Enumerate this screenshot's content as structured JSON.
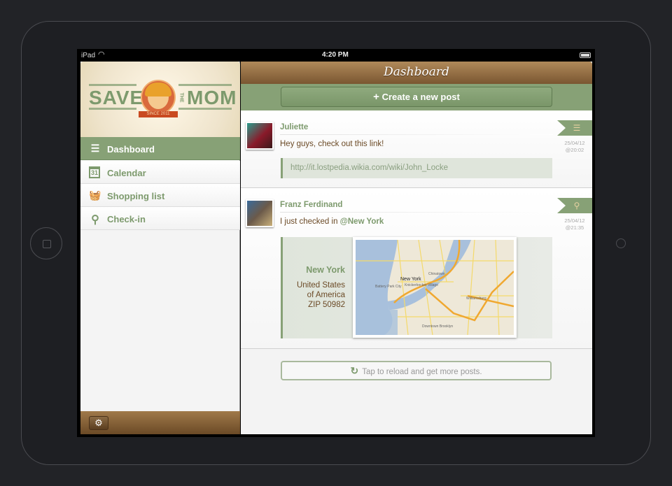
{
  "status_bar": {
    "device": "iPad",
    "time": "4:20 PM"
  },
  "logo": {
    "left": "SAVE",
    "small": "THE",
    "right": "MOM",
    "ribbon": "SINCE 2011"
  },
  "sidebar": {
    "items": [
      {
        "label": "Dashboard",
        "icon": "list-icon",
        "selected": true
      },
      {
        "label": "Calendar",
        "icon": "calendar-icon",
        "icon_text": "31"
      },
      {
        "label": "Shopping list",
        "icon": "basket-icon"
      },
      {
        "label": "Check-in",
        "icon": "map-pin-icon"
      }
    ],
    "settings_icon": "gear-icon"
  },
  "header": {
    "title": "Dashboard"
  },
  "toolbar": {
    "create_label": "Create a new post",
    "create_icon": "+"
  },
  "posts": [
    {
      "author": "Juliette",
      "text": "Hey guys, check out this link!",
      "link": "http://it.lostpedia.wikia.com/wiki/John_Locke",
      "date": "25/04/12",
      "time": "@20:02",
      "type_icon": "list-icon"
    },
    {
      "author": "Franz Ferdinand",
      "text": "I just checked in ",
      "mention": "@New York",
      "date": "25/04/12",
      "time": "@21:35",
      "type_icon": "map-pin-icon",
      "location": {
        "city": "New York",
        "line1": "United States",
        "line2": "of America",
        "zip": "ZIP 50982"
      },
      "map_labels": [
        "New York",
        "Chinatown",
        "Williamsburg",
        "Downtown Brooklyn",
        "Knickerbocker Village",
        "Battery Park City"
      ]
    }
  ],
  "reload": {
    "label": "Tap to reload and get more posts.",
    "icon": "↻"
  },
  "colors": {
    "accent": "#87a176",
    "brown": "#7a5631",
    "text_brown": "#6b4a26"
  }
}
